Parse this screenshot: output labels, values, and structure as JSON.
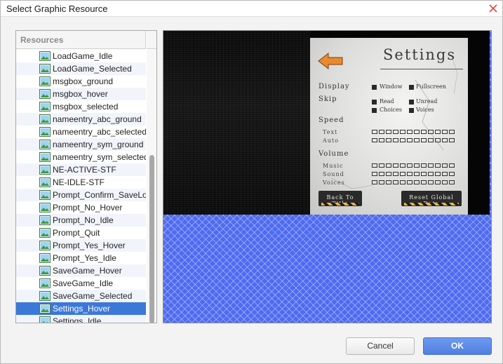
{
  "window": {
    "title": "Select Graphic Resource"
  },
  "resources": {
    "header": "Resources",
    "items": [
      {
        "label": "LoadGame_Idle"
      },
      {
        "label": "LoadGame_Selected"
      },
      {
        "label": "msgbox_ground"
      },
      {
        "label": "msgbox_hover"
      },
      {
        "label": "msgbox_selected"
      },
      {
        "label": "nameentry_abc_ground"
      },
      {
        "label": "nameentry_abc_selected"
      },
      {
        "label": "nameentry_sym_ground"
      },
      {
        "label": "nameentry_sym_selected"
      },
      {
        "label": "NE-ACTIVE-STF"
      },
      {
        "label": "NE-IDLE-STF"
      },
      {
        "label": "Prompt_Confirm_SaveLoad"
      },
      {
        "label": "Prompt_No_Hover"
      },
      {
        "label": "Prompt_No_Idle"
      },
      {
        "label": "Prompt_Quit"
      },
      {
        "label": "Prompt_Yes_Hover"
      },
      {
        "label": "Prompt_Yes_Idle"
      },
      {
        "label": "SaveGame_Hover"
      },
      {
        "label": "SaveGame_Idle"
      },
      {
        "label": "SaveGame_Selected"
      },
      {
        "label": "Settings_Hover",
        "selected": true
      },
      {
        "label": "Settings_Idle"
      }
    ],
    "item_icon": "image-file-icon"
  },
  "preview": {
    "title": "Settings",
    "sections": {
      "display": "Display",
      "skip": "Skip",
      "speed": "Speed",
      "volume": "Volume"
    },
    "options": {
      "window": "Window",
      "fullscreen": "Fullscreen",
      "read": "Read",
      "unread": "Unread",
      "choices": "Choices",
      "voices_skip": "Voices"
    },
    "sub": {
      "text": "Text",
      "auto": "Auto",
      "music": "Music",
      "sound": "Sound",
      "voices": "Voices"
    },
    "buttons": {
      "back": "Back To Title",
      "reset": "Reset Global Data"
    },
    "colors": {
      "checkerboard": "#4f6bf0",
      "arrow": "#e88a2e"
    }
  },
  "footer": {
    "cancel": "Cancel",
    "ok": "OK"
  },
  "colors": {
    "selection": "#3c78d8",
    "ok_button": "#5b8be6"
  }
}
